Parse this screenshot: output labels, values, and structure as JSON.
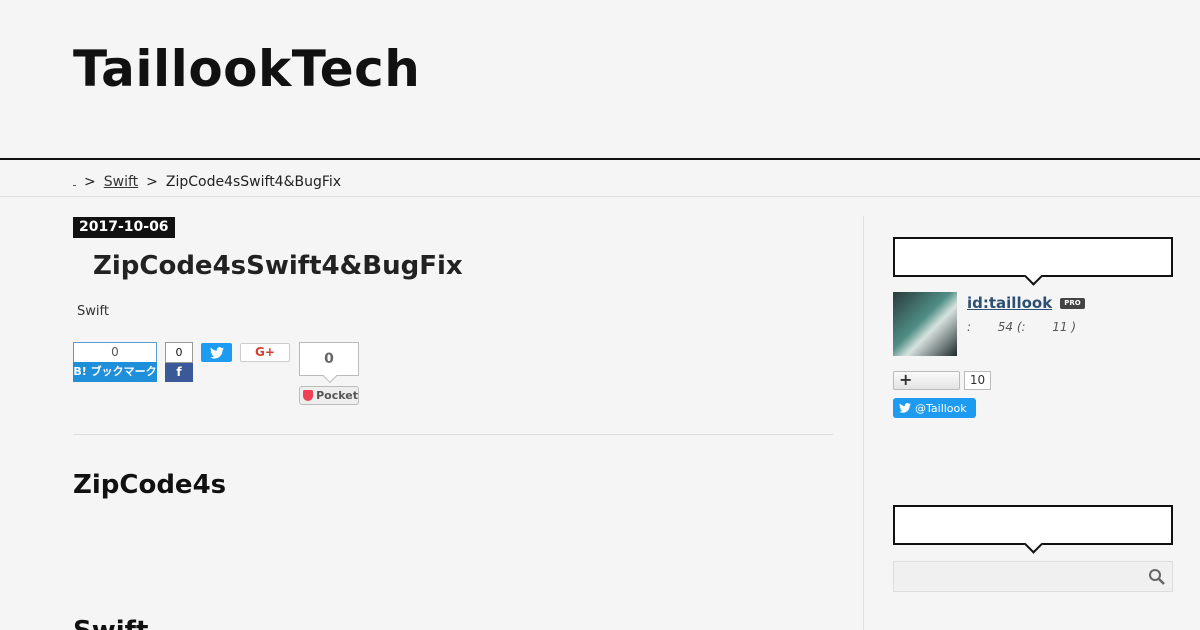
{
  "header": {
    "site_title": "TaillookTech"
  },
  "breadcrumb": {
    "home_label": "",
    "separator": ">",
    "category": "Swift",
    "current": "ZipCode4sSwift4&BugFix"
  },
  "entry": {
    "date": "2017-10-06",
    "title": "ZipCode4sSwift4&BugFix",
    "category": "Swift",
    "share": {
      "hatena_count": "0",
      "hatena_label": "B! ブックマーク",
      "facebook_count": "0",
      "facebook_label": "f",
      "gplus_label": "G+",
      "pocket_count": "0",
      "pocket_label": "Pocket"
    },
    "heading_1": "ZipCode4s",
    "heading_2": "Swift"
  },
  "sidebar": {
    "profile": {
      "id": "id:taillook",
      "pro_badge": "PRO",
      "stats": ":       54 (:       11 )",
      "follow_icon": "+",
      "follow_count": "10",
      "twitter_label": "@Taillook"
    },
    "search": {
      "placeholder": ""
    }
  },
  "colors": {
    "background": "#f5f5f5",
    "hatena": "#1e8fd8",
    "facebook": "#3b5998",
    "twitter": "#1d9bf0",
    "pocket": "#ef4056",
    "link": "#2c4f73"
  },
  "icons": [
    "twitter-icon",
    "facebook-icon",
    "pocket-icon",
    "search-icon",
    "plus-icon"
  ]
}
